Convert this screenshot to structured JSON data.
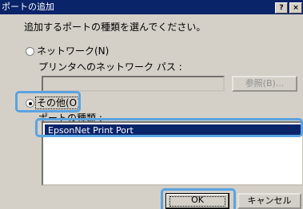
{
  "window": {
    "title": "ポートの追加",
    "help_label": "?",
    "close_label": "×"
  },
  "instruction": "追加するポートの種類を選んでください。",
  "network_option": {
    "label": "ネットワーク(N)",
    "selected": false,
    "path_label": "プリンタへのネットワーク パス :",
    "path_value": "",
    "browse_label": "参照(B)..."
  },
  "other_option": {
    "label": "その他(O)",
    "selected": true,
    "types_label": "ポートの種類 :",
    "port_types": [
      {
        "label": "EpsonNet Print Port",
        "selected": true
      }
    ]
  },
  "buttons": {
    "ok_label": "OK",
    "cancel_label": "キャンセル"
  },
  "highlight_color": "#5aa3e0",
  "selection_color": "#0a246a"
}
